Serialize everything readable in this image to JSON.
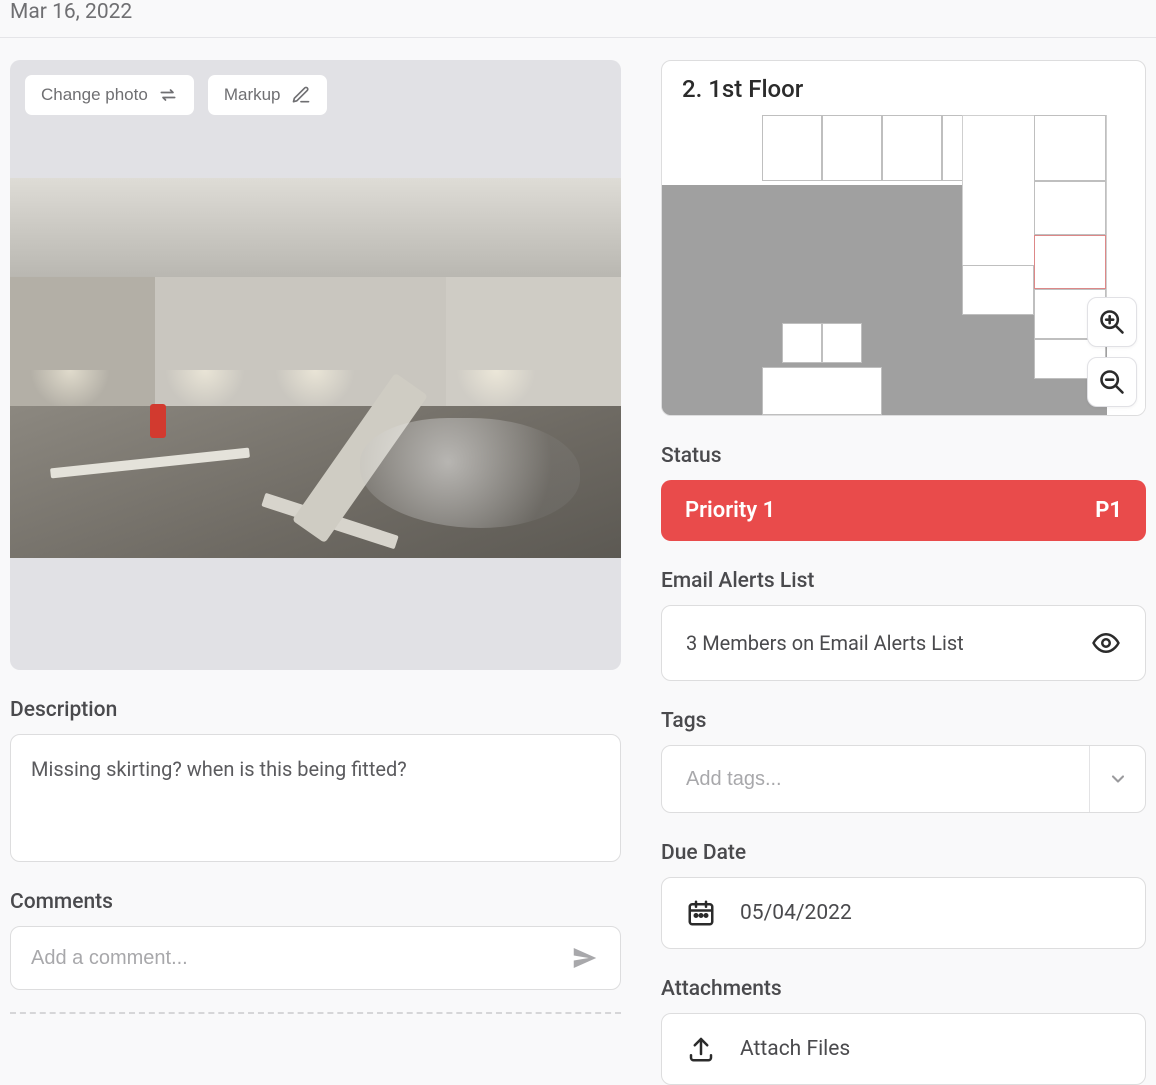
{
  "header": {
    "date": "Mar 16, 2022"
  },
  "photo": {
    "change_label": "Change photo",
    "markup_label": "Markup"
  },
  "description": {
    "title": "Description",
    "text": "Missing skirting? when is this being fitted?"
  },
  "comments": {
    "title": "Comments",
    "placeholder": "Add a comment..."
  },
  "floorplan": {
    "title": "2. 1st Floor"
  },
  "status": {
    "title": "Status",
    "label": "Priority 1",
    "code": "P1",
    "color": "#e94b4b"
  },
  "email_alerts": {
    "title": "Email Alerts List",
    "summary": "3 Members on Email Alerts List"
  },
  "tags": {
    "title": "Tags",
    "placeholder": "Add tags..."
  },
  "due_date": {
    "title": "Due Date",
    "value": "05/04/2022"
  },
  "attachments": {
    "title": "Attachments",
    "button": "Attach Files"
  }
}
